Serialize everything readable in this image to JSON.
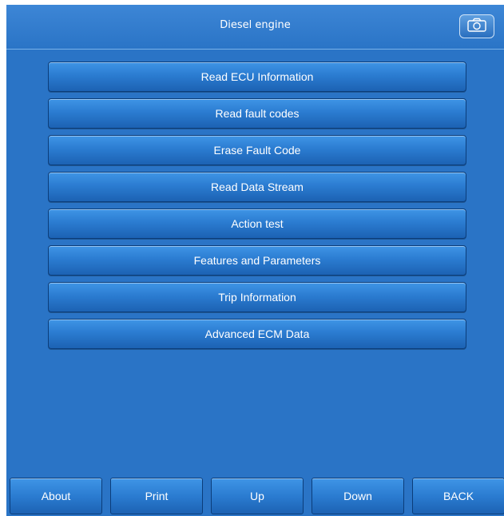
{
  "header": {
    "title": "Diesel engine",
    "camera_icon": "camera-icon"
  },
  "menu": {
    "items": [
      {
        "label": "Read ECU Information"
      },
      {
        "label": "Read fault codes"
      },
      {
        "label": "Erase Fault Code"
      },
      {
        "label": "Read Data Stream"
      },
      {
        "label": "Action test"
      },
      {
        "label": "Features and Parameters"
      },
      {
        "label": "Trip Information"
      },
      {
        "label": "Advanced ECM Data"
      }
    ]
  },
  "footer": {
    "buttons": [
      {
        "label": "About"
      },
      {
        "label": "Print"
      },
      {
        "label": "Up"
      },
      {
        "label": "Down"
      },
      {
        "label": "BACK"
      }
    ]
  },
  "colors": {
    "background": "#2a74c6",
    "button_top": "#3f95e6",
    "button_bottom": "#1c62b3",
    "text": "#ffffff"
  }
}
